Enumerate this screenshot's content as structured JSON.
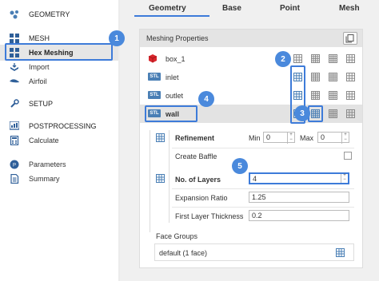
{
  "sidebar": {
    "items": [
      {
        "label": "GEOMETRY",
        "icon": "geometry-icon"
      },
      {
        "label": "MESH",
        "icon": "mesh-icon"
      },
      {
        "label": "Hex Meshing",
        "icon": "hex-mesh-icon"
      },
      {
        "label": "Import",
        "icon": "import-icon"
      },
      {
        "label": "Airfoil",
        "icon": "airfoil-icon"
      },
      {
        "label": "SETUP",
        "icon": "wrench-icon"
      },
      {
        "label": "POSTPROCESSING",
        "icon": "postprocessing-icon"
      },
      {
        "label": "Calculate",
        "icon": "calculator-icon"
      },
      {
        "label": "Parameters",
        "icon": "parameters-icon"
      },
      {
        "label": "Summary",
        "icon": "summary-icon"
      }
    ],
    "selected": "Hex Meshing"
  },
  "badges": [
    "1",
    "2",
    "3",
    "4",
    "5"
  ],
  "tabs": {
    "items": [
      "Geometry",
      "Base",
      "Point",
      "Mesh"
    ],
    "active": "Geometry"
  },
  "panel": {
    "title": "Meshing Properties",
    "rows": [
      {
        "label": "box_1",
        "icon": "box-icon"
      },
      {
        "label": "inlet",
        "icon": "stl-icon",
        "tag": "STL"
      },
      {
        "label": "outlet",
        "icon": "stl-icon",
        "tag": "STL"
      },
      {
        "label": "wall",
        "icon": "stl-icon",
        "tag": "STL"
      }
    ],
    "selected_row": "wall"
  },
  "refinement": {
    "label": "Refinement",
    "min_label": "Min",
    "min_value": "0",
    "max_label": "Max",
    "max_value": "0",
    "create_baffle_label": "Create Baffle",
    "create_baffle_checked": false
  },
  "layers": {
    "count_label": "No. of Layers",
    "count_value": "4",
    "expansion_label": "Expansion Ratio",
    "expansion_value": "1.25",
    "first_layer_label": "First Layer Thickness",
    "first_layer_value": "0.2"
  },
  "face_groups": {
    "label": "Face Groups",
    "value": "default  (1 face)"
  },
  "colors": {
    "accent": "#3d7bd9",
    "badge": "#4a89dc",
    "stl_tag": "#4a7fb5",
    "box": "#d9262c"
  }
}
